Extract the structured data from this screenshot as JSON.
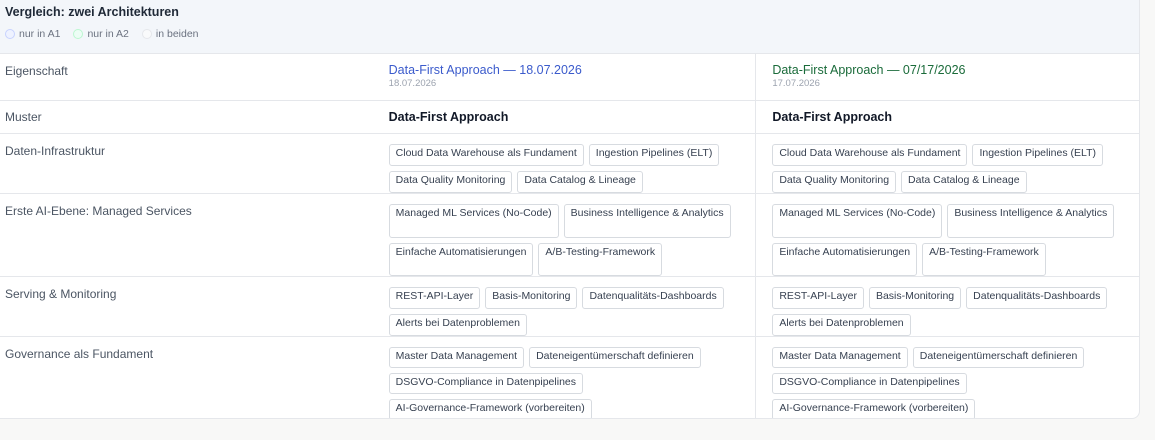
{
  "header": {
    "title": "Vergleich: zwei Architekturen",
    "legend": [
      "nur in A1",
      "nur in A2",
      "in beiden"
    ]
  },
  "columns": {
    "property_label": "Eigenschaft",
    "a1": {
      "title": "Data-First Approach — 18.07.2026",
      "date": "18.07.2026"
    },
    "a2": {
      "title": "Data-First Approach — 07/17/2026",
      "date": "17.07.2026"
    }
  },
  "muster": {
    "label": "Muster",
    "a1": "Data-First Approach",
    "a2": "Data-First Approach"
  },
  "rows": [
    {
      "label": "Daten-Infrastruktur",
      "a1": [
        "Cloud Data Warehouse als Fundament",
        "Ingestion Pipelines (ELT)",
        "Data Quality Monitoring",
        "Data Catalog & Lineage"
      ],
      "a2": [
        "Cloud Data Warehouse als Fundament",
        "Ingestion Pipelines (ELT)",
        "Data Quality Monitoring",
        "Data Catalog & Lineage"
      ]
    },
    {
      "label": "Erste AI-Ebene: Managed Services",
      "a1": [
        "Managed ML Services (No-Code)",
        "Business Intelligence & Analytics",
        "Einfache Automatisierungen",
        "A/B-Testing-Framework"
      ],
      "a2": [
        "Managed ML Services (No-Code)",
        "Business Intelligence & Analytics",
        "Einfache Automatisierungen",
        "A/B-Testing-Framework"
      ]
    },
    {
      "label": "Serving & Monitoring",
      "a1": [
        "REST-API-Layer",
        "Basis-Monitoring",
        "Datenqualitäts-Dashboards",
        "Alerts bei Datenproblemen"
      ],
      "a2": [
        "REST-API-Layer",
        "Basis-Monitoring",
        "Datenqualitäts-Dashboards",
        "Alerts bei Datenproblemen"
      ]
    },
    {
      "label": "Governance als Fundament",
      "a1": [
        "Master Data Management",
        "Dateneigentümerschaft definieren",
        "DSGVO-Compliance in Datenpipelines",
        "AI-Governance-Framework (vorbereiten)"
      ],
      "a2": [
        "Master Data Management",
        "Dateneigentümerschaft definieren",
        "DSGVO-Compliance in Datenpipelines",
        "AI-Governance-Framework (vorbereiten)"
      ]
    }
  ]
}
